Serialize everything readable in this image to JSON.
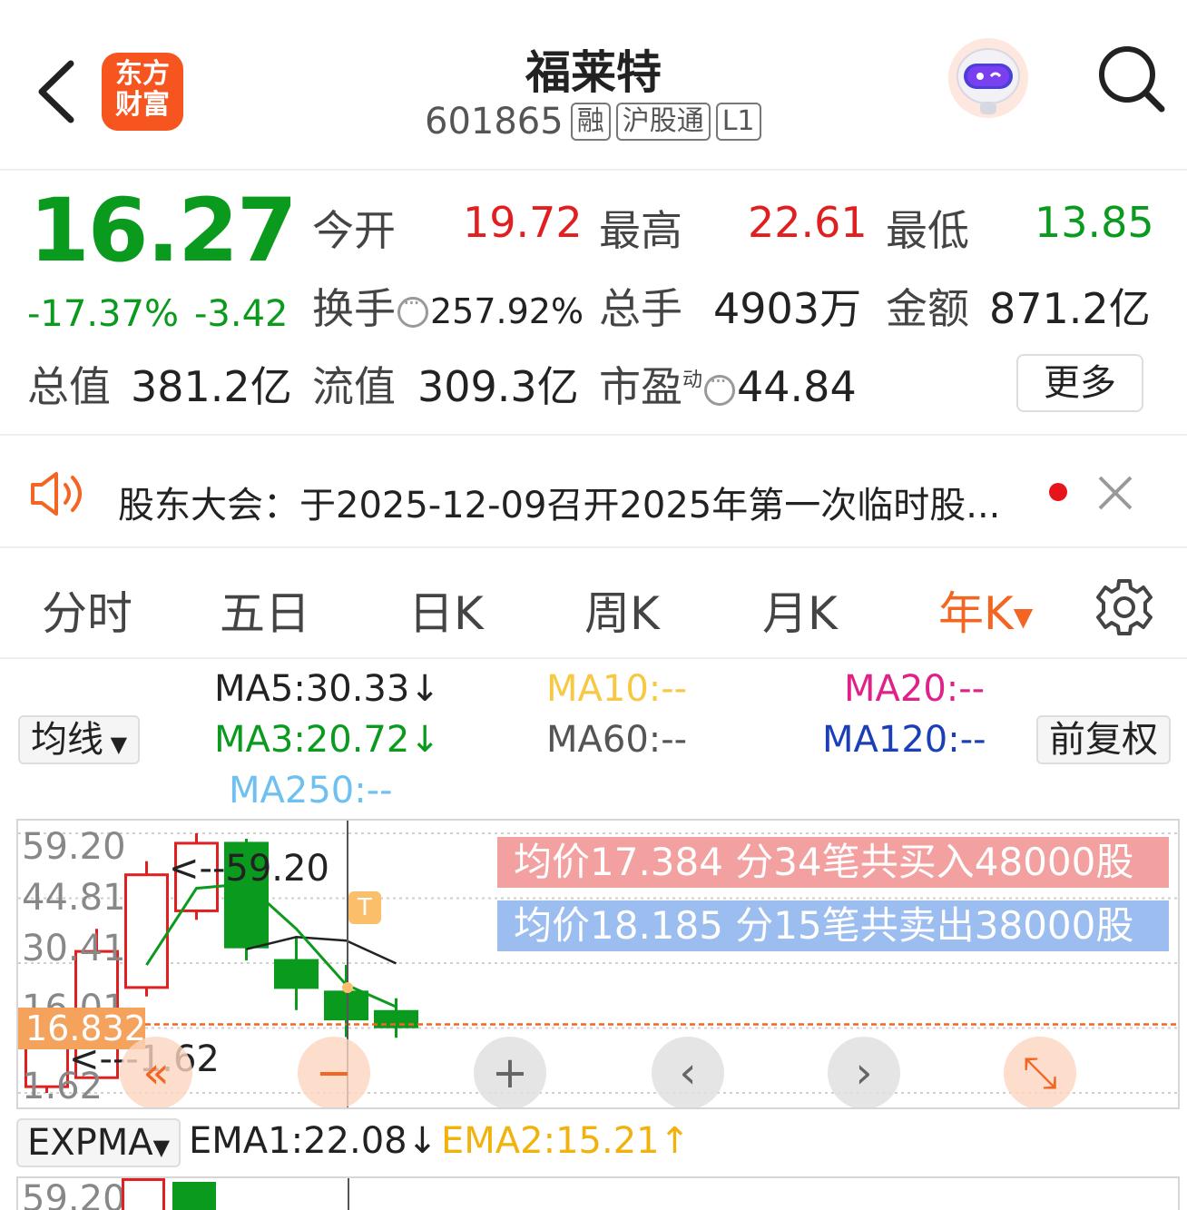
{
  "header": {
    "title": "福莱特",
    "code": "601865",
    "tags": [
      "融",
      "沪股通",
      "L1"
    ],
    "logo_line1": "东方",
    "logo_line2": "财富"
  },
  "quote": {
    "price": "16.27",
    "change_pct": "-17.37%",
    "change_abs": "-3.42",
    "open_label": "今开",
    "open": "19.72",
    "high_label": "最高",
    "high": "22.61",
    "low_label": "最低",
    "low": "13.85",
    "turnover_label": "换手",
    "turnover": "257.92%",
    "volume_label": "总手",
    "volume": "4903万",
    "amount_label": "金额",
    "amount": "871.2亿",
    "mktcap_label": "总值",
    "mktcap": "381.2亿",
    "float_label": "流值",
    "float": "309.3亿",
    "pe_label": "市盈",
    "pe_sup": "动",
    "pe": "44.84",
    "more": "更多"
  },
  "notice": {
    "text": "股东大会：于2025-12-09召开2025年第一次临时股..."
  },
  "tabs": [
    {
      "label": "分时"
    },
    {
      "label": "五日"
    },
    {
      "label": "日K"
    },
    {
      "label": "周K"
    },
    {
      "label": "月K"
    },
    {
      "label": "年K"
    }
  ],
  "ma": {
    "selector": "均线",
    "adjust": "前复权",
    "ma5": "MA5:30.33",
    "ma10": "MA10:--",
    "ma20": "MA20:--",
    "ma3": "MA3:20.72",
    "ma60": "MA60:--",
    "ma120": "MA120:--",
    "ma250": "MA250:--",
    "arrow_down": "↓"
  },
  "chart": {
    "y_labels": [
      "59.20",
      "44.81",
      "30.41",
      "16.01",
      "1.62"
    ],
    "current_price": "16.832",
    "max_marker": "<--59.20",
    "min_marker": "<---1.62",
    "t_marker": "T",
    "buy_text": "均价17.384  分34笔共买入48000股",
    "sell_text": "均价18.185  分15笔共卖出38000股",
    "colors": {
      "up": "#e02020",
      "down": "#0a9a1e",
      "ma5": "#222222",
      "ma3": "#0a9a1e",
      "current": "#f26522"
    }
  },
  "chart_data": {
    "type": "candlestick",
    "ylim": [
      1.62,
      59.2
    ],
    "y_ticks": [
      59.2,
      44.81,
      30.41,
      16.01,
      1.62
    ],
    "candles": [
      {
        "open": 3,
        "close": 12,
        "high": 14,
        "low": 1.62
      },
      {
        "open": 5,
        "close": 33,
        "high": 38,
        "low": 4
      },
      {
        "open": 25,
        "close": 50,
        "high": 53,
        "low": 23
      },
      {
        "open": 42,
        "close": 57,
        "high": 59.2,
        "low": 40
      },
      {
        "open": 57,
        "close": 34,
        "high": 58,
        "low": 31
      },
      {
        "open": 31,
        "close": 25,
        "high": 36,
        "low": 20
      },
      {
        "open": 24,
        "close": 18,
        "high": 30,
        "low": 14
      },
      {
        "open": 19.69,
        "close": 16.27,
        "high": 22.61,
        "low": 13.85
      }
    ],
    "ma5": [
      null,
      null,
      null,
      null,
      33.5,
      36.2,
      35.4,
      30.33
    ],
    "ma3": [
      null,
      null,
      30,
      47,
      48,
      38,
      25.6,
      20.72
    ],
    "current_price": 16.832
  },
  "controls": {
    "left_fast": "«",
    "minus": "−",
    "plus": "+",
    "prev": "‹",
    "next": "›",
    "expand": "⤡"
  },
  "indicator": {
    "selector": "EXPMA",
    "ema1": "EMA1:22.08",
    "ema2": "EMA2:15.21",
    "ema1_arrow": "↓",
    "ema2_arrow": "↑",
    "top_label": "59.20"
  }
}
